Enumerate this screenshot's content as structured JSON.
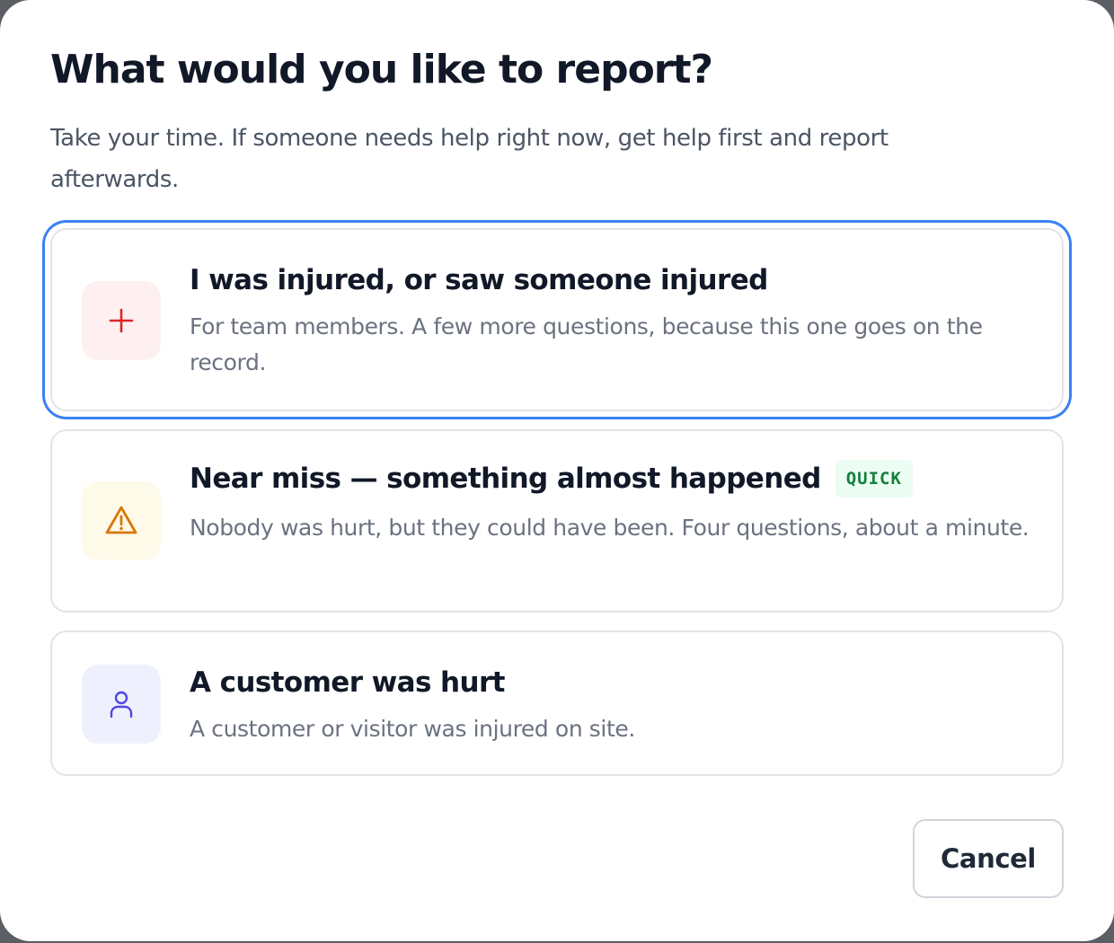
{
  "dialog": {
    "title": "What would you like to report?",
    "subtitle": "Take your time. If someone needs help right now, get help first and report afterwards."
  },
  "options": [
    {
      "icon": "plus-icon",
      "icon_color": "#dc2626",
      "icon_bg": "#fef0f0",
      "title": "I was injured, or saw someone injured",
      "description": "For team members. A few more questions, because this one goes on the record.",
      "selected": true
    },
    {
      "icon": "warning-triangle-icon",
      "icon_color": "#d97706",
      "icon_bg": "#fefaea",
      "title": "Near miss — something almost happened",
      "badge": "QUICK",
      "badge_color": "#15803d",
      "description": "Nobody was hurt, but they could have been. Four questions, about a minute.",
      "selected": false
    },
    {
      "icon": "person-icon",
      "icon_color": "#4f46e5",
      "icon_bg": "#eef1fd",
      "title": "A customer was hurt",
      "description": "A customer or visitor was injured on site.",
      "selected": false
    }
  ],
  "footer": {
    "cancel_label": "Cancel"
  },
  "colors": {
    "focus_ring": "#3b82f6",
    "border": "#e2e4e8"
  }
}
